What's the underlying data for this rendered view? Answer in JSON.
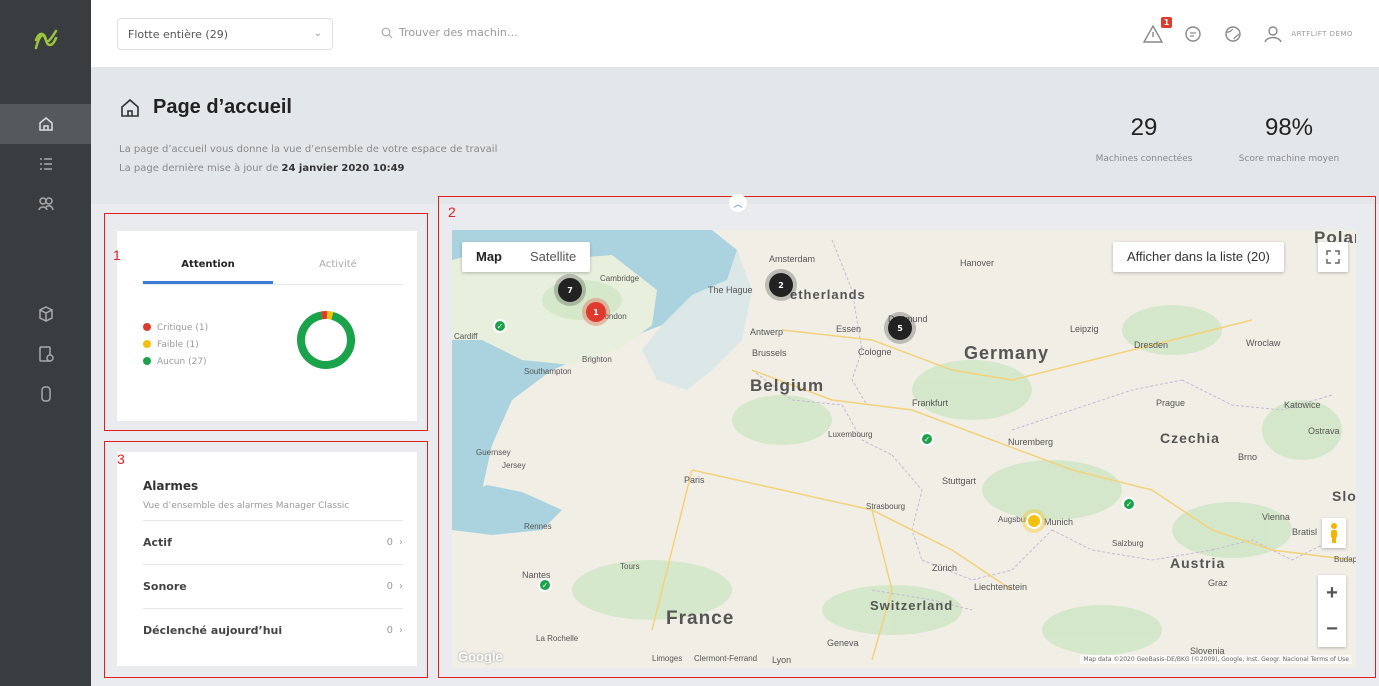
{
  "colors": {
    "sidebar": "#3a3d40",
    "accent": "#3a7bd5",
    "critical": "#e03a2f",
    "weak": "#f4c20d",
    "none": "#1aa34a",
    "annotation": "#e02020"
  },
  "sidebar": {
    "items": [
      {
        "icon": "home-icon",
        "active": true
      },
      {
        "icon": "list-icon",
        "active": false
      },
      {
        "icon": "group-icon",
        "active": false
      },
      {
        "icon": "box-icon",
        "active": false
      },
      {
        "icon": "report-icon",
        "active": false
      },
      {
        "icon": "device-icon",
        "active": false
      }
    ]
  },
  "topbar": {
    "fleet_select": "Flotte entière (29)",
    "search_placeholder": "Trouver des machin…",
    "alert_count": "1",
    "user_name": "ARTFLIFT DEMO"
  },
  "header": {
    "title": "Page d’accueil",
    "desc_line1": "La page d’accueil vous donne la vue d’ensemble de votre espace de travail",
    "desc_line2_prefix": "La page dernière mise à jour de ",
    "desc_line2_date": "24 janvier 2020 10:49",
    "stat1_value": "29",
    "stat1_label": "Machines connectées",
    "stat2_value": "98%",
    "stat2_label": "Score machine moyen"
  },
  "annotations": {
    "box1": "1",
    "box2": "2",
    "box3": "3"
  },
  "attention_card": {
    "tabs": [
      "Attention",
      "Activité"
    ],
    "legend": [
      {
        "label": "Critique (1)",
        "value": 1,
        "color": "#e03a2f"
      },
      {
        "label": "Faible (1)",
        "value": 1,
        "color": "#f4c20d"
      },
      {
        "label": "Aucun (27)",
        "value": 27,
        "color": "#1aa34a"
      }
    ]
  },
  "alarms_card": {
    "title": "Alarmes",
    "subtitle": "Vue d’ensemble des alarmes Manager Classic",
    "rows": [
      {
        "label": "Actif",
        "value": "0"
      },
      {
        "label": "Sonore",
        "value": "0"
      },
      {
        "label": "Déclenché aujourd’hui",
        "value": "0"
      }
    ]
  },
  "map": {
    "toggle_map": "Map",
    "toggle_satellite": "Satellite",
    "list_button": "Afficher dans la liste (20)",
    "google": "Google",
    "attribution": "Map data ©2020 GeoBasis-DE/BKG (©2009), Google, Inst. Geogr. Nacional    Terms of Use",
    "countries": {
      "belgium": "Belgium",
      "germany": "Germany",
      "france": "France",
      "czechia": "Czechia",
      "austria": "Austria",
      "switzerland": "Switzerland",
      "netherlands": "etherlands",
      "poland": "Polan",
      "slovakia": "Slo"
    },
    "cities": {
      "amsterdam": "Amsterdam",
      "the_hague": "The Hague",
      "antwerp": "Antwerp",
      "brussels": "Brussels",
      "essen": "Essen",
      "dortmund": "Dortmund",
      "cologne": "Cologne",
      "hanover": "Hanover",
      "leipzig": "Leipzig",
      "dresden": "Dresden",
      "wroclaw": "Wroclaw",
      "frankfurt": "Frankfurt",
      "prague": "Prague",
      "katowice": "Katowice",
      "nuremberg": "Nuremberg",
      "luxembourg": "Luxembourg",
      "paris": "Paris",
      "stuttgart": "Stuttgart",
      "strasbourg": "Strasbourg",
      "munich": "Munich",
      "augsburg": "Augsburg",
      "vienna": "Vienna",
      "bratislava": "Bratisl",
      "brno": "Brno",
      "ostrava": "Ostrava",
      "zurich": "Zürich",
      "liechtenstein": "Liechtenstein",
      "geneva": "Geneva",
      "lyon": "Lyon",
      "nantes": "Nantes",
      "rennes": "Rennes",
      "tours": "Tours",
      "la_rochelle": "La Rochelle",
      "limoges": "Limoges",
      "clermont": "Clermont-Ferrand",
      "graz": "Graz",
      "slovenia": "Slovenia",
      "guernsey": "Guernsey",
      "jersey": "Jersey",
      "cambridge": "Cambridge",
      "london": "London",
      "brighton": "Brighton",
      "southampton": "Southampton",
      "cardiff": "Cardiff",
      "salzburg": "Salzburg",
      "budapest": "Budap"
    },
    "clusters": [
      {
        "id": "uk-cluster",
        "count": "7"
      },
      {
        "id": "london-cluster",
        "count": "1"
      },
      {
        "id": "amsterdam-cluster",
        "count": "2"
      },
      {
        "id": "ruhr-cluster",
        "count": "5"
      }
    ]
  }
}
